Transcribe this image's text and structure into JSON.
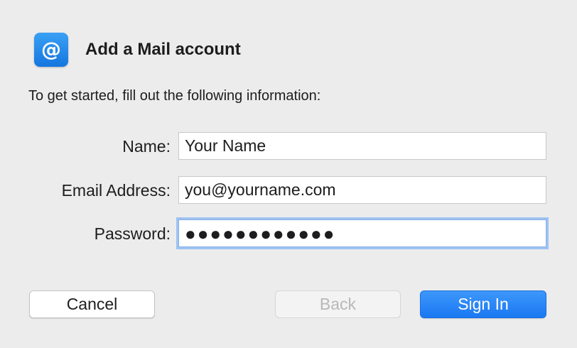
{
  "dialog": {
    "title": "Add a Mail account",
    "intro": "To get started, fill out the following information:",
    "icon": "at-sign-icon",
    "accent_color": "#1a78f2"
  },
  "form": {
    "name": {
      "label": "Name:",
      "value": "Your Name"
    },
    "email": {
      "label": "Email Address:",
      "value": "you@yourname.com"
    },
    "password": {
      "label": "Password:",
      "masked_value": "●●●●●●●●●●●●",
      "focused": true
    }
  },
  "buttons": {
    "cancel": "Cancel",
    "back": "Back",
    "back_disabled": true,
    "sign_in": "Sign In"
  }
}
